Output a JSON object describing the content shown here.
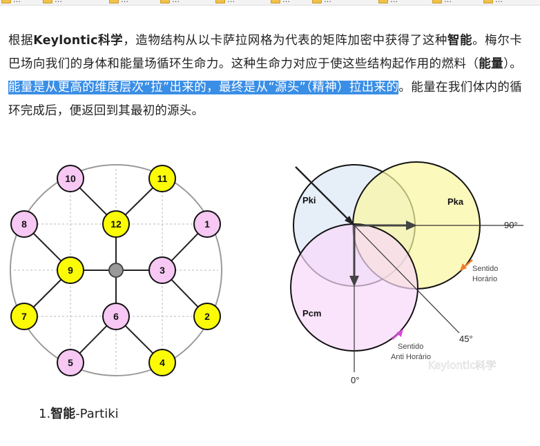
{
  "bookmarks": [
    {
      "label": "…"
    },
    {
      "label": "…"
    },
    {
      "label": "…"
    },
    {
      "label": "…"
    },
    {
      "label": "…"
    },
    {
      "label": "…"
    },
    {
      "label": "…"
    },
    {
      "label": "…"
    },
    {
      "label": "…"
    },
    {
      "label": "…"
    }
  ],
  "paragraph": {
    "part1": "根据",
    "brand": "Keylontic科学",
    "part2": "，造物结构从以卡萨拉网格为代表的矩阵加密中获得了这种",
    "bold_intelligence": "智能",
    "part3": "。梅尔卡巴场向我们的身体和能量场循环生命力。这种生命力对应于使这些结构起作用的燃料（",
    "bold_energy": "能量",
    "part4": "）。",
    "highlighted": "能量是从更高的维度层次“拉”出来的，最终是从“源头”（精神）拉出来的",
    "part5": "。能量在我们体内的循环完成后，便返回到其最初的源头。"
  },
  "grid": {
    "nodes": [
      {
        "label": "10",
        "color": "pink"
      },
      {
        "label": "11",
        "color": "yellow"
      },
      {
        "label": "8",
        "color": "pink"
      },
      {
        "label": "12",
        "color": "yellow"
      },
      {
        "label": "1",
        "color": "pink"
      },
      {
        "label": "9",
        "color": "yellow"
      },
      {
        "label": "3",
        "color": "pink"
      },
      {
        "label": "7",
        "color": "yellow"
      },
      {
        "label": "6",
        "color": "pink"
      },
      {
        "label": "2",
        "color": "yellow"
      },
      {
        "label": "5",
        "color": "pink"
      },
      {
        "label": "4",
        "color": "yellow"
      }
    ]
  },
  "venn": {
    "pki": "Pki",
    "pka": "Pka",
    "pcm": "Pcm",
    "deg90": "90°",
    "deg45": "45°",
    "deg0": "0°",
    "sentido1": "Sentido",
    "horario": "Horário",
    "sentido2": "Sentido",
    "anti_horario": "Anti Horário",
    "watermark": "Keylontic科学"
  },
  "caption": {
    "number": "1.",
    "bold": "智能",
    "rest": "-Partiki"
  },
  "colors": {
    "pink": "#f7c8f3",
    "yellow": "#fbfb06",
    "highlight": "#3a8ee6",
    "pki": "#e2ebf7",
    "pka": "#fbf6a0",
    "pcm": "#f8d9fa"
  }
}
